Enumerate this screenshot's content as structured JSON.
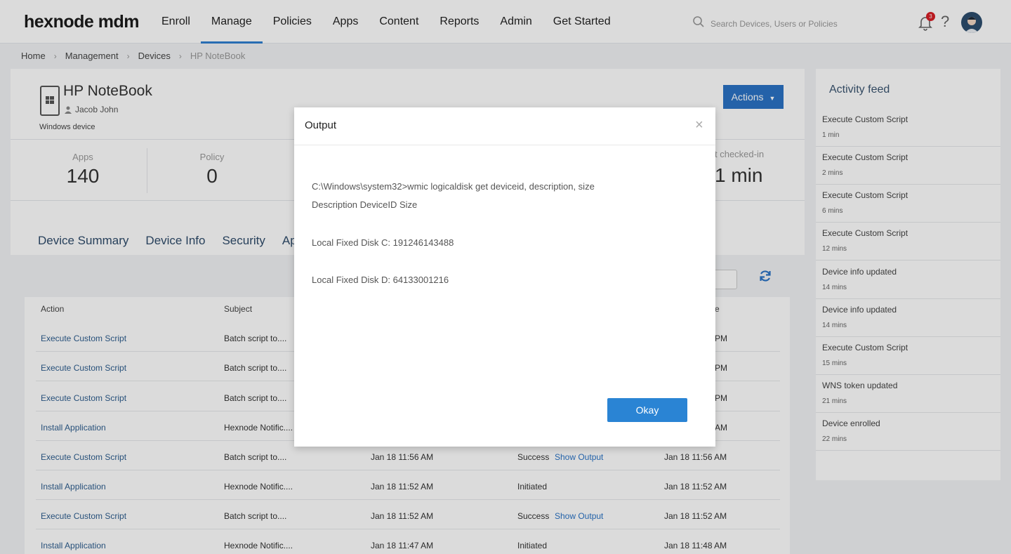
{
  "app": {
    "logo": "hexnode mdm"
  },
  "nav": {
    "items": [
      "Enroll",
      "Manage",
      "Policies",
      "Apps",
      "Content",
      "Reports",
      "Admin",
      "Get Started"
    ],
    "active": "Manage"
  },
  "search": {
    "placeholder": "Search Devices, Users or Policies"
  },
  "notifications": {
    "count": "3"
  },
  "help_label": "?",
  "breadcrumb": [
    "Home",
    "Management",
    "Devices",
    "HP NoteBook"
  ],
  "device": {
    "name": "HP NoteBook",
    "user": "Jacob John",
    "type": "Windows device",
    "actions_label": "Actions"
  },
  "stats": {
    "apps": {
      "label": "Apps",
      "value": "140"
    },
    "policy": {
      "label": "Policy",
      "value": "0"
    },
    "last_checked_label": "t checked-in",
    "last_checked_value": "1 min"
  },
  "tabs": [
    "Device Summary",
    "Device Info",
    "Security",
    "Ap"
  ],
  "table": {
    "headers": [
      "Action",
      "Subject",
      "e"
    ],
    "rows": [
      {
        "action": "Execute Custom Script",
        "subject": "Batch script to....",
        "time": "",
        "status": "",
        "output": "",
        "end": "PM"
      },
      {
        "action": "Execute Custom Script",
        "subject": "Batch script to....",
        "time": "",
        "status": "",
        "output": "",
        "end": "PM"
      },
      {
        "action": "Execute Custom Script",
        "subject": "Batch script to....",
        "time": "",
        "status": "",
        "output": "",
        "end": "PM"
      },
      {
        "action": "Install Application",
        "subject": "Hexnode Notific....",
        "time": "",
        "status": "",
        "output": "",
        "end": "AM"
      },
      {
        "action": "Execute Custom Script",
        "subject": "Batch script to....",
        "time": "Jan 18 11:56 AM",
        "status": "Success",
        "output": "Show Output",
        "end": "Jan 18 11:56 AM"
      },
      {
        "action": "Install Application",
        "subject": "Hexnode Notific....",
        "time": "Jan 18 11:52 AM",
        "status": "Initiated",
        "output": "",
        "end": "Jan 18 11:52 AM"
      },
      {
        "action": "Execute Custom Script",
        "subject": "Batch script to....",
        "time": "Jan 18 11:52 AM",
        "status": "Success",
        "output": "Show Output",
        "end": "Jan 18 11:52 AM"
      },
      {
        "action": "Install Application",
        "subject": "Hexnode Notific....",
        "time": "Jan 18 11:47 AM",
        "status": "Initiated",
        "output": "",
        "end": "Jan 18 11:48 AM"
      }
    ]
  },
  "feed": {
    "title": "Activity feed",
    "items": [
      {
        "label": "Execute Custom Script",
        "time": "1 min"
      },
      {
        "label": "Execute Custom Script",
        "time": "2 mins"
      },
      {
        "label": "Execute Custom Script",
        "time": "6 mins"
      },
      {
        "label": "Execute Custom Script",
        "time": "12 mins"
      },
      {
        "label": "Device info updated",
        "time": "14 mins"
      },
      {
        "label": "Device info updated",
        "time": "14 mins"
      },
      {
        "label": "Execute Custom Script",
        "time": "15 mins"
      },
      {
        "label": "WNS token updated",
        "time": "21 mins"
      },
      {
        "label": "Device enrolled",
        "time": "22 mins"
      }
    ]
  },
  "modal": {
    "title": "Output",
    "close": "×",
    "lines": [
      "C:\\Windows\\system32>wmic logicaldisk get deviceid, description, size",
      "Description DeviceID Size",
      "Local Fixed Disk C: 191246143488",
      "Local Fixed Disk D: 64133001216"
    ],
    "okay_label": "Okay"
  }
}
